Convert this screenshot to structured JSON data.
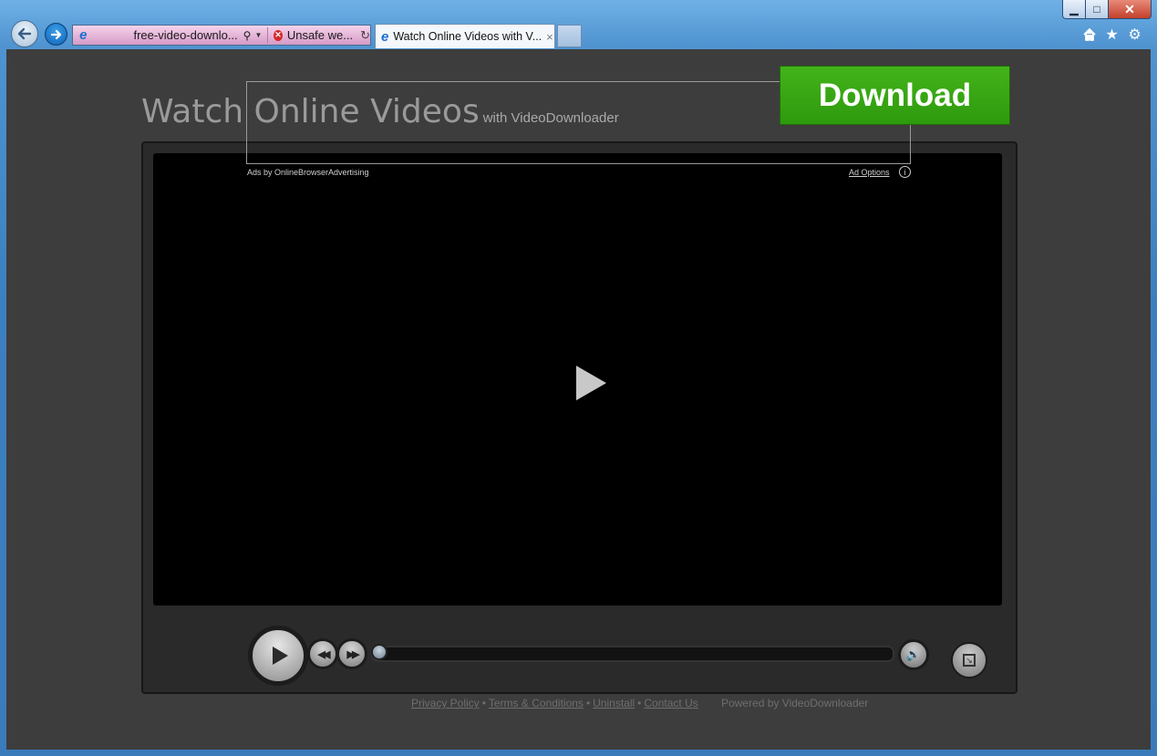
{
  "browser": {
    "address": {
      "url": "free-video-downlo...",
      "unsafe_label": "Unsafe we..."
    },
    "tab": {
      "title": "Watch Online Videos with V...",
      "close": "×"
    },
    "window_controls": {
      "minimize": "▁",
      "maximize": "□",
      "close": "✕"
    },
    "toolbar_icons": [
      "home-icon",
      "star-icon",
      "gear-icon"
    ],
    "colors": {
      "address_bg": "#e3b2d8",
      "frame": "#3c7fc0"
    }
  },
  "page": {
    "headline": "Watch Online Videos",
    "headline_sub": "with VideoDownloader",
    "ad": {
      "download_label": "Download",
      "ads_by": "Ads by OnlineBrowserAdvertising",
      "ad_options": "Ad Options",
      "info": "i",
      "download_color": "#35a612"
    },
    "player": {
      "progress": 0.02,
      "rewind_glyph": "◀◀",
      "forward_glyph": "▶▶",
      "volume_glyph": "🔊",
      "fullscreen_glyph": "↘"
    },
    "footer": {
      "links": [
        "Privacy Policy",
        "Terms & Conditions",
        "Uninstall",
        "Contact Us"
      ],
      "separator": "•",
      "powered_by": "Powered by VideoDownloader"
    }
  }
}
